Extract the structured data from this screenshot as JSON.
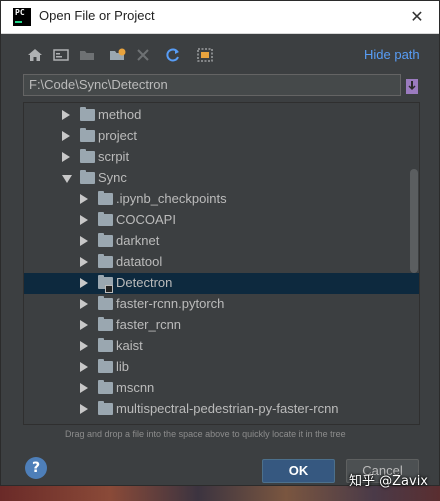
{
  "window": {
    "title": "Open File or Project",
    "app_icon_text": "PC",
    "close_glyph": "✕"
  },
  "toolbar": {
    "icons": [
      "home-icon",
      "desktop-icon",
      "project-folder-icon",
      "new-folder-icon",
      "delete-icon",
      "refresh-icon",
      "show-hidden-icon"
    ],
    "hide_path_label": "Hide path"
  },
  "path": {
    "value": "F:\\Code\\Sync\\Detectron"
  },
  "tree": {
    "rows": [
      {
        "label": "method",
        "expanded": false,
        "level": 2,
        "selected": false
      },
      {
        "label": "project",
        "expanded": false,
        "level": 2,
        "selected": false
      },
      {
        "label": "scrpit",
        "expanded": false,
        "level": 2,
        "selected": false
      },
      {
        "label": "Sync",
        "expanded": true,
        "level": 2,
        "selected": false
      },
      {
        "label": ".ipynb_checkpoints",
        "expanded": false,
        "level": 3,
        "selected": false
      },
      {
        "label": "COCOAPI",
        "expanded": false,
        "level": 3,
        "selected": false
      },
      {
        "label": "darknet",
        "expanded": false,
        "level": 3,
        "selected": false
      },
      {
        "label": "datatool",
        "expanded": false,
        "level": 3,
        "selected": false
      },
      {
        "label": "Detectron",
        "expanded": false,
        "level": 3,
        "selected": true
      },
      {
        "label": "faster-rcnn.pytorch",
        "expanded": false,
        "level": 3,
        "selected": false
      },
      {
        "label": "faster_rcnn",
        "expanded": false,
        "level": 3,
        "selected": false
      },
      {
        "label": "kaist",
        "expanded": false,
        "level": 3,
        "selected": false
      },
      {
        "label": "lib",
        "expanded": false,
        "level": 3,
        "selected": false
      },
      {
        "label": "mscnn",
        "expanded": false,
        "level": 3,
        "selected": false
      },
      {
        "label": "multispectral-pedestrian-py-faster-rcnn",
        "expanded": false,
        "level": 3,
        "selected": false
      }
    ]
  },
  "hint": "Drag and drop a file into the space above to quickly locate it in the tree",
  "buttons": {
    "help": "?",
    "ok": "OK",
    "cancel": "Cancel"
  },
  "watermark": "知乎 @Zavix",
  "colors": {
    "dialog_bg": "#3c3f41",
    "selection": "#0d293e",
    "link": "#589df6",
    "ok_button": "#365880"
  }
}
